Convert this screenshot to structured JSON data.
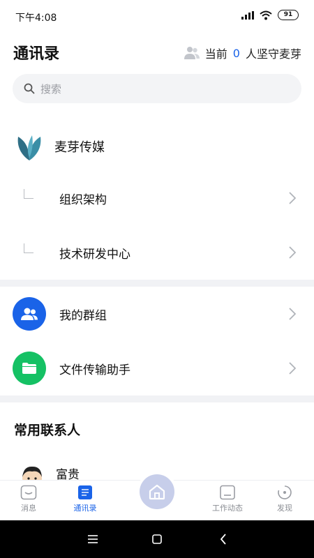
{
  "status_bar": {
    "time": "下午4:08",
    "battery": "91"
  },
  "header": {
    "title": "通讯录",
    "online_prefix": "当前",
    "online_count": "0",
    "online_suffix": "人坚守麦芽"
  },
  "search": {
    "placeholder": "搜索"
  },
  "org": {
    "name": "麦芽传媒",
    "children": [
      {
        "label": "组织架构"
      },
      {
        "label": "技术研发中心"
      }
    ]
  },
  "menu": [
    {
      "label": "我的群组",
      "icon": "group-icon",
      "color": "#1a63e8"
    },
    {
      "label": "文件传输助手",
      "icon": "folder-icon",
      "color": "#15c164"
    }
  ],
  "frequent_contacts": {
    "title": "常用联系人",
    "items": [
      {
        "name": "富贵"
      }
    ]
  },
  "tabbar": {
    "tabs": [
      {
        "label": "消息",
        "icon": "message-icon"
      },
      {
        "label": "通讯录",
        "icon": "contacts-icon",
        "active": true
      },
      {
        "label": "",
        "icon": "home-icon"
      },
      {
        "label": "工作动态",
        "icon": "work-feed-icon"
      },
      {
        "label": "发现",
        "icon": "discover-icon"
      }
    ]
  },
  "colors": {
    "accent": "#1a63e8",
    "green": "#15c164",
    "logo": "#2f6f86"
  }
}
